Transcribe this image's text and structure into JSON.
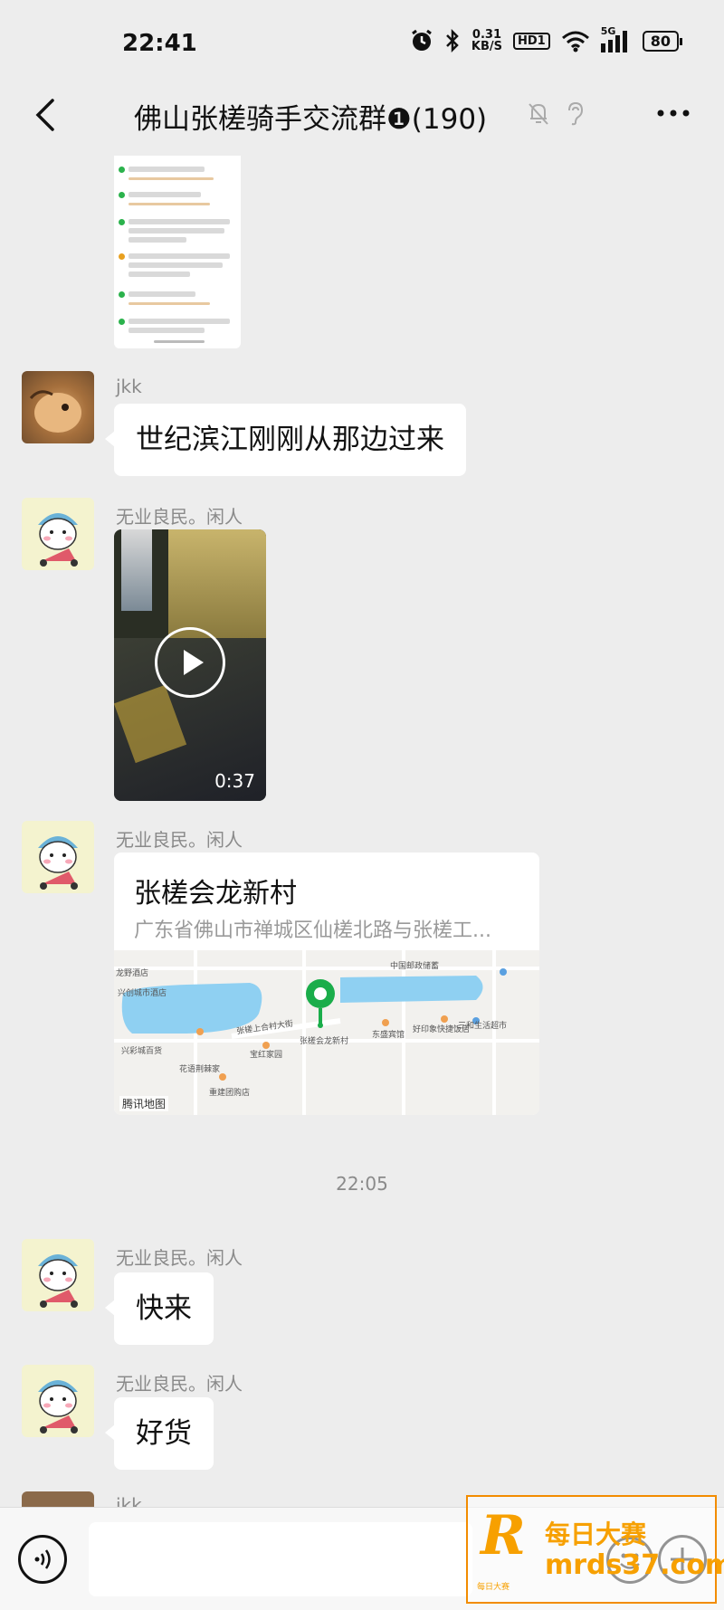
{
  "status_bar": {
    "time": "22:41",
    "net_speed_value": "0.31",
    "net_speed_unit": "KB/S",
    "hd_label": "HD1",
    "network_label": "5G",
    "battery": "80"
  },
  "header": {
    "title": "佛山张槎骑手交流群❶(190)"
  },
  "messages": [
    {
      "sender": "jkk",
      "text": "世纪滨江刚刚从那边过来"
    },
    {
      "sender": "无业良民。闲人",
      "video_duration": "0:37"
    },
    {
      "sender": "无业良民。闲人",
      "location_title": "张槎会龙新村",
      "location_address": "广东省佛山市禅城区仙槎北路与张槎工...",
      "map_brand": "腾讯地图"
    },
    {
      "sender": "无业良民。闲人",
      "text": "快来"
    },
    {
      "sender": "无业良民。闲人",
      "text": "好货"
    },
    {
      "sender": "jkk"
    }
  ],
  "timestamp": "22:05",
  "map_labels": [
    "中国邮政储蓄",
    "张槎会龙新村",
    "东盛宾馆",
    "好印象快捷饭店",
    "兴创城市酒店",
    "宝红家园",
    "三和生活超市",
    "花语荆棘家",
    "重建团购店",
    "张槎上合村大街",
    "龙野酒店",
    "兴彩城百货"
  ],
  "watermark": {
    "line1": "每日大赛",
    "line2": "mrds37.com",
    "small": "每日大赛"
  },
  "colors": {
    "background": "#ededed",
    "bubble": "#ffffff",
    "map_pin": "#1aad4a",
    "lake": "#8fd0f2",
    "watermark": "#f7a000"
  },
  "icons": [
    "back-arrow-icon",
    "mute-bell-icon",
    "ear-icon",
    "more-icon",
    "alarm-icon",
    "bluetooth-icon",
    "wifi-icon",
    "signal-icon",
    "voice-icon",
    "emoji-icon",
    "plus-icon",
    "play-icon",
    "map-pin-icon"
  ]
}
